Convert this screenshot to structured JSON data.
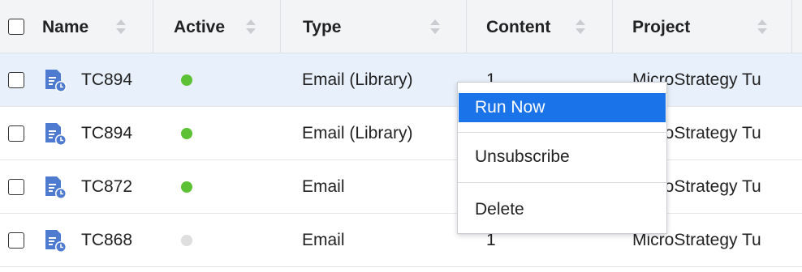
{
  "header": {
    "columns": [
      {
        "label": "Name"
      },
      {
        "label": "Active"
      },
      {
        "label": "Type"
      },
      {
        "label": "Content"
      },
      {
        "label": "Project"
      }
    ]
  },
  "rows": [
    {
      "name": "TC894",
      "active": true,
      "type": "Email (Library)",
      "content": "1",
      "project": "MicroStrategy Tu",
      "selected": true
    },
    {
      "name": "TC894",
      "active": true,
      "type": "Email (Library)",
      "content": "",
      "project": "MicroStrategy Tu",
      "selected": false
    },
    {
      "name": "TC872",
      "active": true,
      "type": "Email",
      "content": "",
      "project": "MicroStrategy Tu",
      "selected": false
    },
    {
      "name": "TC868",
      "active": false,
      "type": "Email",
      "content": "1",
      "project": "MicroStrategy Tu",
      "selected": false
    }
  ],
  "context_menu": {
    "items": [
      {
        "label": "Run Now"
      },
      {
        "label": "Unsubscribe"
      },
      {
        "label": "Delete"
      }
    ]
  },
  "icons": {
    "row_icon": "scheduled-document-icon",
    "active_on": "green-dot-icon",
    "active_off": "grey-dot-icon"
  },
  "colors": {
    "active_dot": "#5cc135",
    "inactive_dot": "#dedede",
    "selected_row": "#e8f0fb",
    "menu_highlight": "#1a73e8",
    "icon_blue": "#4e7ad0"
  }
}
